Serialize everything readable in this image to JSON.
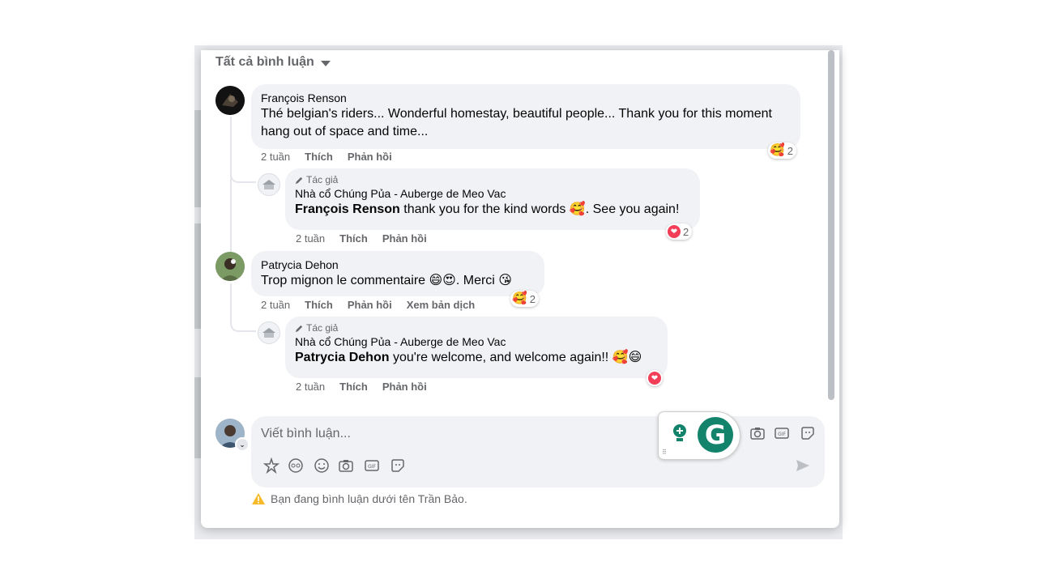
{
  "filter": {
    "label": "Tất cả bình luận"
  },
  "comments": [
    {
      "author": "François Renson",
      "text": "Thé belgian's riders... Wonderful homestay, beautiful people... Thank you for this moment hang out of space and time...",
      "time": "2 tuần",
      "like": "Thích",
      "reply": "Phản hồi",
      "reaction_count": "2",
      "reply_item": {
        "badge": "Tác giả",
        "author": "Nhà cổ Chúng Pủa - Auberge de Meo Vac",
        "mention": "François Renson",
        "text": "thank you for the kind words 🥰. See you again!",
        "time": "2 tuần",
        "like": "Thích",
        "reply": "Phản hồi",
        "reaction_count": "2"
      }
    },
    {
      "author": "Patrycia Dehon",
      "text": "Trop mignon le commentaire 😄😍. Merci 😘",
      "time": "2 tuần",
      "like": "Thích",
      "reply": "Phản hồi",
      "translate": "Xem bản dịch",
      "reaction_count": "2",
      "reply_item": {
        "badge": "Tác giả",
        "author": "Nhà cổ Chúng Pủa - Auberge de Meo Vac",
        "mention": "Patrycia Dehon",
        "text": "you're welcome, and welcome again!! 🥰😄",
        "time": "2 tuần",
        "like": "Thích",
        "reply": "Phản hồi"
      }
    }
  ],
  "composer": {
    "placeholder": "Viết bình luận..."
  },
  "warning": {
    "text": "Bạn đang bình luận dưới tên Trần Bảo."
  },
  "colors": {
    "bubble": "#f0f2f5",
    "meta": "#65676b",
    "heart": "#f33e58",
    "grammarly": "#13836b"
  }
}
